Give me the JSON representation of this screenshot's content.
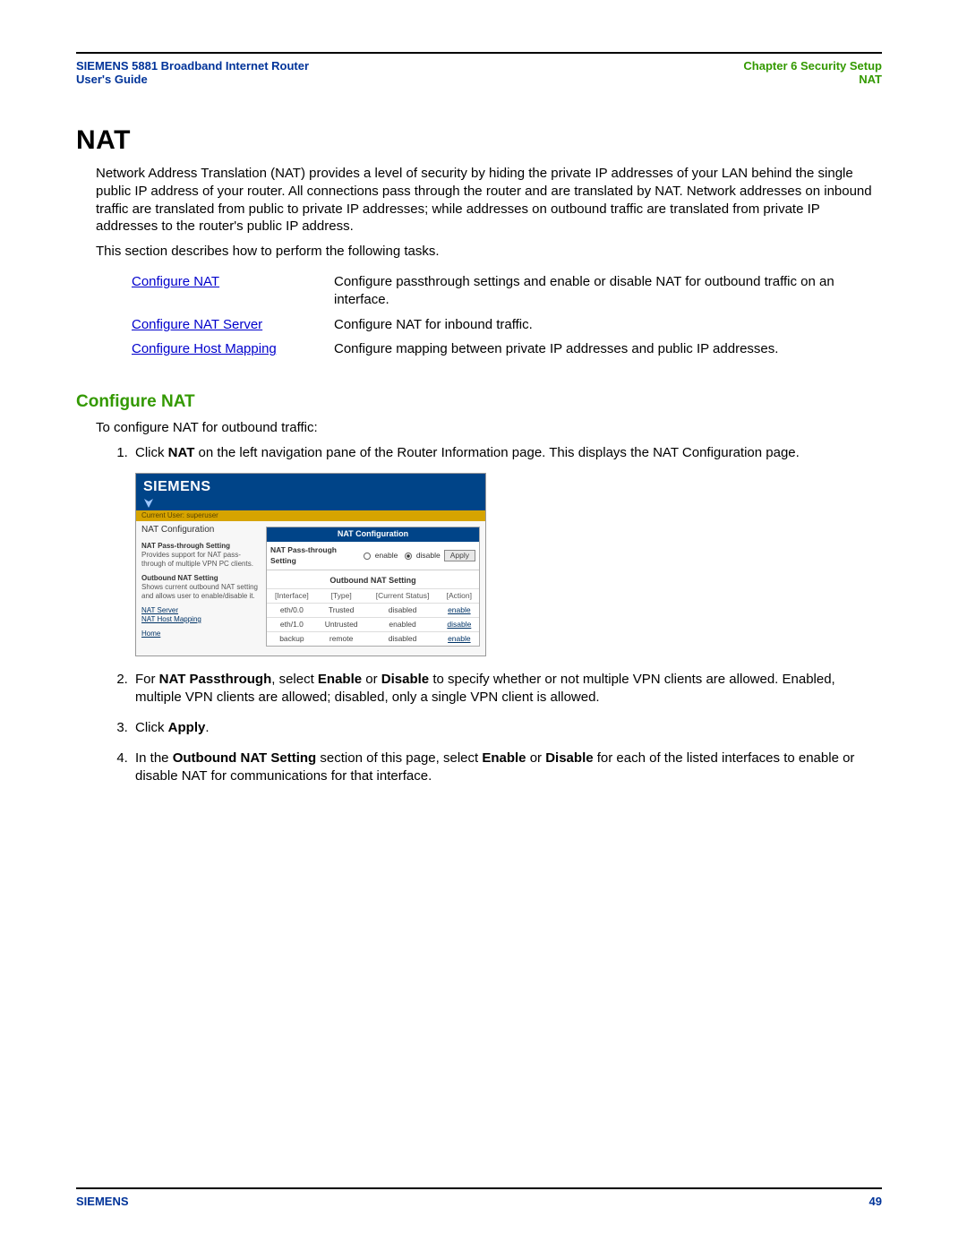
{
  "header": {
    "left_line1": "SIEMENS 5881 Broadband Internet Router",
    "left_line2": "User's Guide",
    "right_line1": "Chapter 6  Security Setup",
    "right_line2": "NAT"
  },
  "h1": "NAT",
  "intro_p1": "Network Address Translation (NAT) provides a level of security by hiding the private IP addresses of your LAN behind the single public IP address of your router. All connections pass through the router and are translated by NAT. Network addresses on inbound traffic are translated from public to private IP addresses; while addresses on outbound traffic are translated from private IP addresses to the router's public IP address.",
  "intro_p2": "This section describes how to perform the following tasks.",
  "tasks": [
    {
      "link": "Configure NAT",
      "desc": "Configure passthrough settings and enable or disable NAT for outbound traffic on an interface."
    },
    {
      "link": "Configure NAT Server",
      "desc": "Configure NAT for inbound traffic."
    },
    {
      "link": "Configure Host Mapping",
      "desc": "Configure mapping between private IP addresses and public IP addresses."
    }
  ],
  "h2": "Configure NAT",
  "lead": "To configure NAT for outbound traffic:",
  "steps": {
    "s1_pre": "Click ",
    "s1_bold": "NAT",
    "s1_post": " on the left navigation pane of the Router Information page. This displays the NAT Configuration page.",
    "s2_pre": "For ",
    "s2_b1": "NAT Passthrough",
    "s2_mid1": ", select ",
    "s2_b2": "Enable",
    "s2_mid2": " or ",
    "s2_b3": "Disable",
    "s2_post": " to specify whether or not multiple VPN clients are allowed. Enabled, multiple VPN clients are allowed; disabled, only a single VPN client is allowed.",
    "s3_pre": "Click ",
    "s3_b": "Apply",
    "s3_post": ".",
    "s4_pre": "In the ",
    "s4_b1": "Outbound NAT Setting",
    "s4_mid1": " section of this page, select ",
    "s4_b2": "Enable",
    "s4_mid2": " or ",
    "s4_b3": "Disable",
    "s4_post": " for each of the listed interfaces to enable or disable NAT for communications for that interface."
  },
  "router": {
    "brand": "SIEMENS",
    "goldbar": "Current User: superuser",
    "nav_title": "NAT Configuration",
    "nav1_head": "NAT Pass-through Setting",
    "nav1_desc": "Provides support for NAT pass-through of multiple VPN PC clients.",
    "nav2_head": "Outbound NAT Setting",
    "nav2_desc": "Shows current outbound NAT setting and allows user to enable/disable it.",
    "link_server": "NAT Server",
    "link_hostmap": "NAT Host Mapping",
    "link_home": "Home",
    "panel_title": "NAT Configuration",
    "pass_label": "NAT Pass-through Setting",
    "opt_enable": "enable",
    "opt_disable": "disable",
    "apply": "Apply",
    "out_title": "Outbound NAT Setting",
    "out_headers": [
      "[Interface]",
      "[Type]",
      "[Current Status]",
      "[Action]"
    ],
    "out_rows": [
      {
        "if": "eth/0.0",
        "type": "Trusted",
        "status": "disabled",
        "action": "enable"
      },
      {
        "if": "eth/1.0",
        "type": "Untrusted",
        "status": "enabled",
        "action": "disable"
      },
      {
        "if": "backup",
        "type": "remote",
        "status": "disabled",
        "action": "enable"
      }
    ]
  },
  "footer": {
    "left": "SIEMENS",
    "right": "49"
  }
}
